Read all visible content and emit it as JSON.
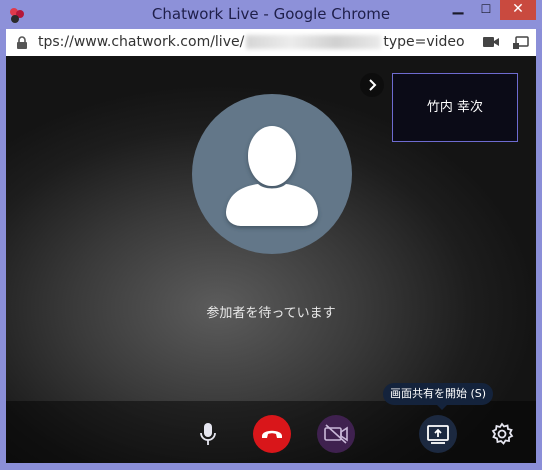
{
  "window": {
    "title": "Chatwork Live - Google Chrome",
    "minimize_glyph": "▁",
    "maximize_glyph": "☐",
    "close_glyph": "✕"
  },
  "addressbar": {
    "url_start": "tps://www.chatwork.com/live/",
    "url_end": "type=video"
  },
  "call": {
    "waiting_message": "参加者を待っています",
    "participant_name": "竹内 幸次",
    "expand_glyph": "›"
  },
  "controls": {
    "share_tooltip": "画面共有を開始 (S)"
  },
  "colors": {
    "titlebar": "#8d91d9",
    "close_button": "#c94a3f",
    "hangup": "#d9161a",
    "video_off": "#3f214f",
    "share": "#1c2940",
    "avatar_bg": "#637789",
    "participant_border": "#6e6bd0"
  },
  "icons": [
    "app-icon",
    "lock-icon",
    "camera-icon",
    "cast-icon",
    "avatar-icon",
    "microphone-icon",
    "hangup-icon",
    "video-off-icon",
    "screen-share-icon",
    "gear-icon",
    "chevron-right-icon"
  ]
}
